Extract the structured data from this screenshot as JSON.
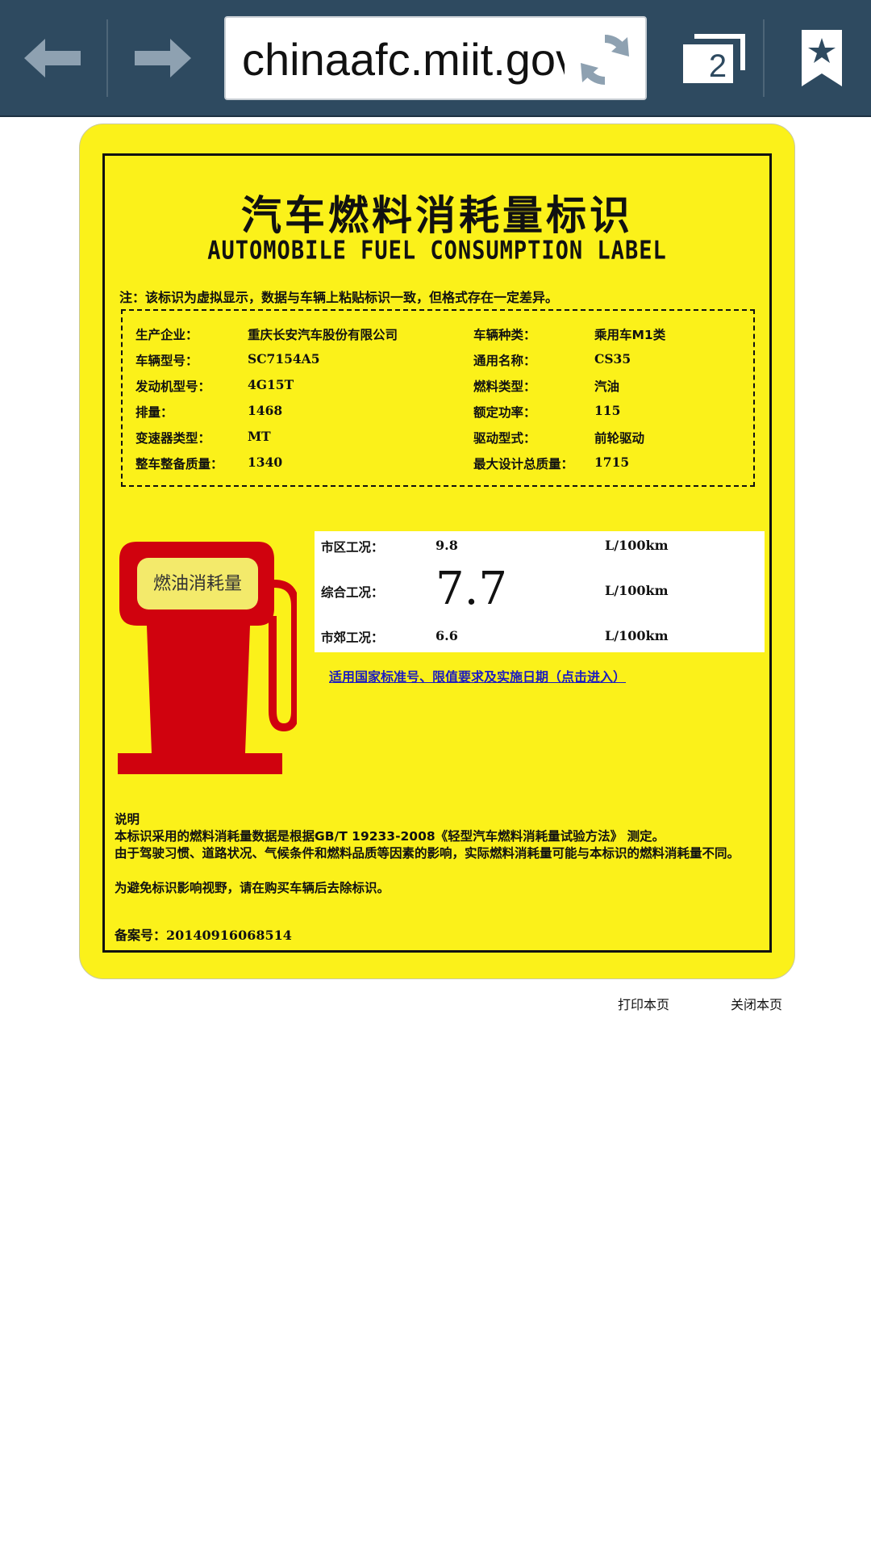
{
  "browser": {
    "url": "chinaafc.miit.gov",
    "tab_count": "2",
    "icons": [
      "back-arrow-icon",
      "forward-arrow-icon",
      "reload-icon",
      "tabs-icon",
      "bookmark-icon"
    ]
  },
  "label": {
    "title_cn": "汽车燃料消耗量标识",
    "title_en": "AUTOMOBILE FUEL CONSUMPTION LABEL",
    "note": "注：该标识为虚拟显示，数据与车辆上粘贴标识一致，但格式存在一定差异。",
    "info": [
      {
        "k1": "生产企业：",
        "v1": "重庆长安汽车股份有限公司",
        "k2": "车辆种类：",
        "v2": "乘用车M1类"
      },
      {
        "k1": "车辆型号：",
        "v1": "SC7154A5",
        "k2": "通用名称：",
        "v2": "CS35"
      },
      {
        "k1": "发动机型号：",
        "v1": "4G15T",
        "k2": "燃料类型：",
        "v2": "汽油"
      },
      {
        "k1": "排量：",
        "v1": "1468",
        "k2": "额定功率：",
        "v2": "115"
      },
      {
        "k1": "变速器类型：",
        "v1": "MT",
        "k2": "驱动型式：",
        "v2": "前轮驱动"
      },
      {
        "k1": "整车整备质量：",
        "v1": "1340",
        "k2": "最大设计总质量：",
        "v2": "1715"
      }
    ],
    "pump_text": "燃油消耗量",
    "consumption": {
      "urban": {
        "label": "市区工况：",
        "value": "9.8",
        "unit": "L/100km"
      },
      "combined": {
        "label": "综合工况：",
        "value": "7.7",
        "unit": "L/100km"
      },
      "suburban": {
        "label": "市郊工况：",
        "value": "6.6",
        "unit": "L/100km"
      }
    },
    "standard_link": "适用国家标准号、限值要求及实施日期（点击进入）",
    "explain_title": "说明",
    "explain_1": "本标识采用的燃料消耗量数据是根据GB/T 19233-2008《轻型汽车燃料消耗量试验方法》 测定。",
    "explain_2": "由于驾驶习惯、道路状况、气候条件和燃料品质等因素的影响，实际燃料消耗量可能与本标识的燃料消耗量不同。",
    "explain_3": "为避免标识影响视野，请在购买车辆后去除标识。",
    "record": "备案号：20140916068514",
    "colors": {
      "label_bg": "#fbf11a",
      "pump": "#d0020e",
      "toolbar": "#2e4a60",
      "link": "#1c1cc0"
    }
  },
  "page_actions": {
    "print": "打印本页",
    "close": "关闭本页"
  }
}
